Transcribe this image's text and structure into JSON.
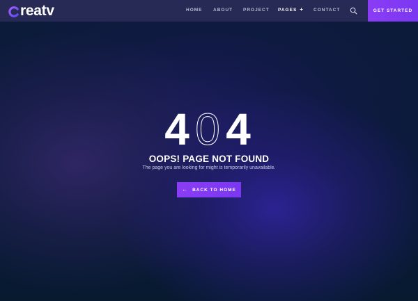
{
  "header": {
    "logo_text": "reatv",
    "nav": [
      {
        "label": "HOME"
      },
      {
        "label": "ABOUT"
      },
      {
        "label": "PROJECT"
      },
      {
        "label": "PAGES"
      },
      {
        "label": "CONTACT"
      }
    ],
    "cta_label": "GET STARTED"
  },
  "error": {
    "code_digits": [
      "4",
      "0",
      "4"
    ],
    "title": "OOPS! PAGE NOT FOUND",
    "subtitle": "The page you are looking for might is temporarily unavailable.",
    "button_label": "BACK TO HOME"
  },
  "colors": {
    "accent": "#8b3cf5",
    "header_bg": "#262a55",
    "background": "#071a30"
  }
}
